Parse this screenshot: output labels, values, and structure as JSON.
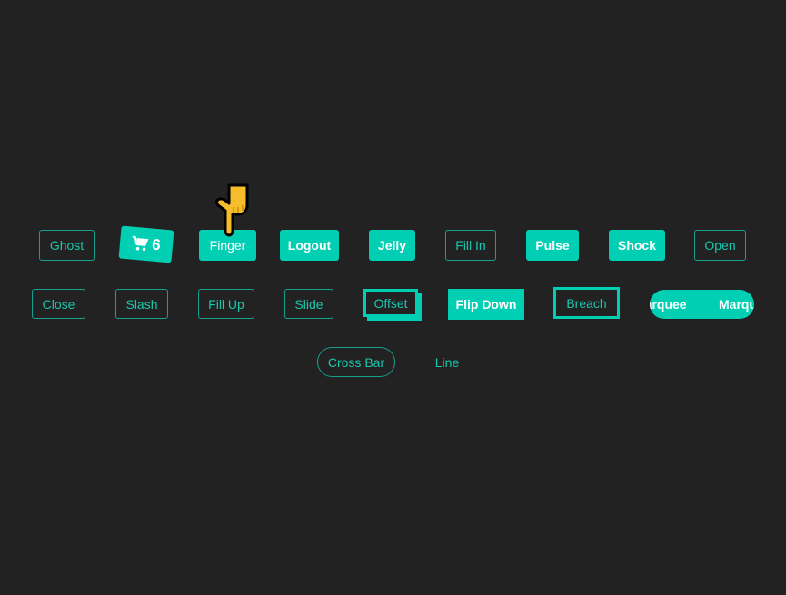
{
  "accent_color": "#00cfb4",
  "background_color": "#222222",
  "row1": {
    "ghost": "Ghost",
    "cart": {
      "icon": "cart-icon",
      "count": "6"
    },
    "finger": "Finger",
    "logout": "Logout",
    "jelly": "Jelly",
    "fill_in": "Fill In",
    "pulse": "Pulse",
    "shock": "Shock",
    "open": "Open"
  },
  "row2": {
    "close": "Close",
    "slash": "Slash",
    "fill_up": "Fill Up",
    "slide": "Slide",
    "offset": "Offset",
    "flip_down": "Flip Down",
    "breach": "Breach",
    "marquee": "Marquee"
  },
  "row3": {
    "cross_bar": "Cross Bar",
    "line": "Line"
  },
  "cursor_icon": "pointing-hand-cursor-icon"
}
